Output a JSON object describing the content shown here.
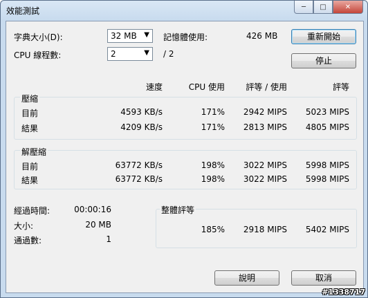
{
  "window": {
    "title": "效能測試"
  },
  "settings": {
    "dict_label": "字典大小(D):",
    "dict_value": "32 MB",
    "threads_label": "CPU 線程數:",
    "threads_value": "2",
    "threads_total": "/ 2",
    "memory_label": "記憶體使用:",
    "memory_value": "426 MB"
  },
  "buttons": {
    "restart": "重新開始",
    "stop": "停止",
    "help": "說明",
    "cancel": "取消"
  },
  "columns": {
    "speed": "速度",
    "cpu": "CPU 使用",
    "rating_usage": "評等 / 使用",
    "rating": "評等"
  },
  "compress": {
    "title": "壓縮",
    "rows": [
      {
        "label": "目前",
        "speed": "4593 KB/s",
        "cpu": "171%",
        "rating_usage": "2942 MIPS",
        "rating": "5023 MIPS"
      },
      {
        "label": "結果",
        "speed": "4209 KB/s",
        "cpu": "171%",
        "rating_usage": "2813 MIPS",
        "rating": "4805 MIPS"
      }
    ]
  },
  "decompress": {
    "title": "解壓縮",
    "rows": [
      {
        "label": "目前",
        "speed": "63772 KB/s",
        "cpu": "198%",
        "rating_usage": "3022 MIPS",
        "rating": "5998 MIPS"
      },
      {
        "label": "結果",
        "speed": "63772 KB/s",
        "cpu": "198%",
        "rating_usage": "3022 MIPS",
        "rating": "5998 MIPS"
      }
    ]
  },
  "stats": {
    "elapsed_label": "經過時間:",
    "elapsed_value": "00:00:16",
    "size_label": "大小:",
    "size_value": "20 MB",
    "passes_label": "通過數:",
    "passes_value": "1"
  },
  "overall": {
    "title": "整體評等",
    "cpu": "185%",
    "rating_usage": "2918 MIPS",
    "rating": "5402 MIPS"
  },
  "watermark": "#1338717"
}
